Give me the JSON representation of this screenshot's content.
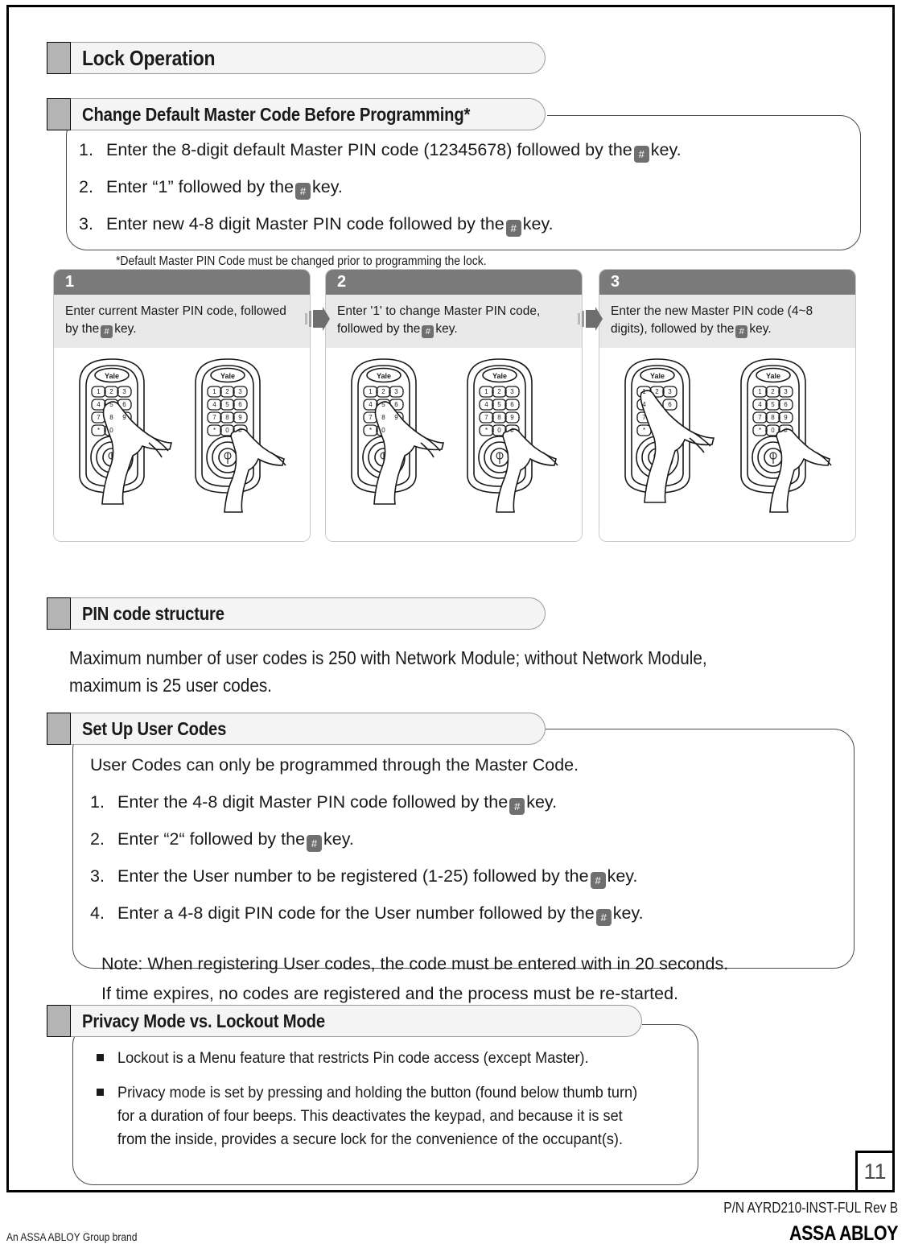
{
  "page": {
    "number": "11",
    "footer_left": "An ASSA ABLOY Group brand",
    "footer_part_number": "P/N AYRD210-INST-FUL Rev B",
    "footer_logo": "ASSA ABLOY"
  },
  "sections": {
    "lock_operation": {
      "title": "Lock Operation"
    },
    "change_master": {
      "title": "Change Default Master Code Before Programming*",
      "steps": [
        {
          "num": "1.",
          "before": "Enter the 8-digit default Master PIN code (12345678) followed by the",
          "after": "key."
        },
        {
          "num": "2.",
          "before": "Enter “1” followed by the",
          "after": "key."
        },
        {
          "num": "3.",
          "before": "Enter new 4-8 digit Master PIN code followed by the",
          "after": "key."
        }
      ],
      "footnote": "*Default Master PIN Code must be changed prior to programming the lock."
    },
    "pin_structure": {
      "title": "PIN code structure",
      "line1": "Maximum number of user codes is 250 with Network Module; without Network Module,",
      "line2": "maximum is 25 user codes."
    },
    "set_up_user_codes": {
      "title": "Set Up User Codes",
      "intro": "User Codes can only be programmed through the Master Code.",
      "steps": [
        {
          "num": "1.",
          "before": "Enter the 4-8 digit Master PIN code followed by the",
          "after": "key."
        },
        {
          "num": "2.",
          "before": "Enter “2“ followed by the",
          "after": "key."
        },
        {
          "num": "3.",
          "before": "Enter the User number to be registered (1-25) followed by the",
          "after": "key."
        },
        {
          "num": "4.",
          "before": "Enter a 4-8 digit PIN code for the User number followed by the",
          "after": "key."
        }
      ],
      "note1": "Note: When registering User codes, the code must be entered with in 20 seconds.",
      "note2": "If time expires, no codes are registered and the process must be re-started."
    },
    "privacy_lockout": {
      "title": "Privacy Mode vs. Lockout Mode",
      "bullets": [
        "Lockout is a Menu feature that restricts Pin code access (except Master).",
        "Privacy mode is set by pressing and holding the button (found below thumb turn) for a duration of four beeps. This deactivates the keypad, and because it is set from the inside, provides a secure lock for the convenience of the occupant(s)."
      ]
    }
  },
  "step_panels": [
    {
      "number": "1",
      "caption_before": "Enter current Master PIN code, followed by the",
      "caption_after": "key.",
      "left_lock_pressed_key": "5",
      "right_lock_pressed_key": "#"
    },
    {
      "number": "2",
      "caption_before": "Enter '1' to change Master PIN code, followed by the",
      "caption_after": "key.",
      "left_lock_pressed_key": "5",
      "right_lock_pressed_key": "#"
    },
    {
      "number": "3",
      "caption_before": "Enter the new Master PIN code (4~8 digits), followed by the",
      "caption_after": "key.",
      "left_lock_pressed_key": "1",
      "right_lock_pressed_key": "#"
    }
  ],
  "keypad": {
    "brand": "Yale",
    "keys": [
      "1",
      "2",
      "3",
      "4",
      "5",
      "6",
      "7",
      "8",
      "9",
      "*",
      "0",
      "#"
    ]
  },
  "glyphs": {
    "hash_key": "#"
  },
  "colors": {
    "header_tab_bg": "#f4f4f4",
    "header_square": "#b4b4b4",
    "step_header_bg": "#7a7a7a",
    "step_caption_bg": "#e9e9e9",
    "hash_key_bg": "#6f6f6f",
    "text": "#1a1a1a"
  }
}
